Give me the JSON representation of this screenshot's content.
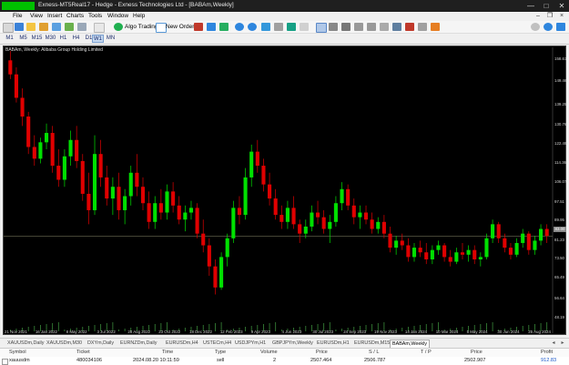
{
  "window": {
    "title": "Exness-MT5Real17 - Hedge - Exness Technologies Ltd - [BABAm,Weekly]",
    "controls": [
      "—",
      "□",
      "✕"
    ]
  },
  "menu": {
    "items": [
      "File",
      "View",
      "Insert",
      "Charts",
      "Tools",
      "Window",
      "Help"
    ]
  },
  "toolbar": {
    "algo_label": "Algo Trading",
    "new_order_label": "New Order"
  },
  "timeframes": [
    "M1",
    "M5",
    "M15",
    "M30",
    "H1",
    "H4",
    "D1",
    "W1",
    "MN"
  ],
  "active_timeframe": "W1",
  "chart": {
    "caption": "BABAm, Weekly:  Alibaba Group Holding Limited",
    "current_price_label": "83.00",
    "bull_color": "#00e000",
    "bear_color": "#e00000",
    "price_line_color": "#8a8a6a"
  },
  "chart_data": {
    "type": "candlestick",
    "y_ticks": [
      "158.61",
      "149.46",
      "139.25",
      "130.76",
      "122.49",
      "114.36",
      "106.07",
      "97.51",
      "89.95",
      "81.23",
      "73.50",
      "65.49",
      "56.64",
      "48.19"
    ],
    "x_ticks": [
      "21 Nov 2021",
      "16 Jan 2022",
      "8 May 2022",
      "3 Jul 2022",
      "28 Aug 2022",
      "23 Oct 2022",
      "18 Dec 2022",
      "12 Feb 2023",
      "9 Apr 2023",
      "4 Jun 2023",
      "30 Jul 2023",
      "24 Sep 2023",
      "19 Nov 2023",
      "14 Jan 2024",
      "10 Mar 2024",
      "5 May 2024",
      "30 Jun 2024",
      "25 Aug 2024"
    ],
    "ylim": [
      45,
      162
    ],
    "current_price": 83.0,
    "candles": [
      {
        "o": 158,
        "h": 162,
        "l": 150,
        "c": 152
      },
      {
        "o": 152,
        "h": 155,
        "l": 140,
        "c": 142
      },
      {
        "o": 142,
        "h": 146,
        "l": 130,
        "c": 134
      },
      {
        "o": 134,
        "h": 136,
        "l": 118,
        "c": 121
      },
      {
        "o": 121,
        "h": 126,
        "l": 113,
        "c": 116
      },
      {
        "o": 116,
        "h": 125,
        "l": 114,
        "c": 123
      },
      {
        "o": 123,
        "h": 131,
        "l": 120,
        "c": 127
      },
      {
        "o": 127,
        "h": 130,
        "l": 110,
        "c": 113
      },
      {
        "o": 113,
        "h": 120,
        "l": 104,
        "c": 107
      },
      {
        "o": 107,
        "h": 120,
        "l": 104,
        "c": 117
      },
      {
        "o": 117,
        "h": 128,
        "l": 113,
        "c": 124
      },
      {
        "o": 124,
        "h": 130,
        "l": 112,
        "c": 115
      },
      {
        "o": 115,
        "h": 118,
        "l": 98,
        "c": 101
      },
      {
        "o": 101,
        "h": 110,
        "l": 88,
        "c": 94
      },
      {
        "o": 94,
        "h": 126,
        "l": 92,
        "c": 118
      },
      {
        "o": 118,
        "h": 124,
        "l": 104,
        "c": 108
      },
      {
        "o": 108,
        "h": 113,
        "l": 96,
        "c": 99
      },
      {
        "o": 99,
        "h": 108,
        "l": 92,
        "c": 104
      },
      {
        "o": 104,
        "h": 110,
        "l": 90,
        "c": 94
      },
      {
        "o": 94,
        "h": 103,
        "l": 88,
        "c": 100
      },
      {
        "o": 100,
        "h": 113,
        "l": 96,
        "c": 110
      },
      {
        "o": 110,
        "h": 118,
        "l": 100,
        "c": 104
      },
      {
        "o": 104,
        "h": 108,
        "l": 94,
        "c": 97
      },
      {
        "o": 97,
        "h": 102,
        "l": 86,
        "c": 89
      },
      {
        "o": 89,
        "h": 100,
        "l": 86,
        "c": 97
      },
      {
        "o": 97,
        "h": 103,
        "l": 90,
        "c": 93
      },
      {
        "o": 93,
        "h": 105,
        "l": 90,
        "c": 102
      },
      {
        "o": 102,
        "h": 106,
        "l": 93,
        "c": 96
      },
      {
        "o": 96,
        "h": 100,
        "l": 88,
        "c": 90
      },
      {
        "o": 90,
        "h": 96,
        "l": 85,
        "c": 93
      },
      {
        "o": 93,
        "h": 98,
        "l": 90,
        "c": 95
      },
      {
        "o": 95,
        "h": 97,
        "l": 82,
        "c": 84
      },
      {
        "o": 84,
        "h": 90,
        "l": 76,
        "c": 79
      },
      {
        "o": 79,
        "h": 82,
        "l": 66,
        "c": 70
      },
      {
        "o": 70,
        "h": 73,
        "l": 58,
        "c": 61
      },
      {
        "o": 61,
        "h": 76,
        "l": 60,
        "c": 74
      },
      {
        "o": 74,
        "h": 84,
        "l": 70,
        "c": 82
      },
      {
        "o": 82,
        "h": 98,
        "l": 80,
        "c": 95
      },
      {
        "o": 95,
        "h": 100,
        "l": 88,
        "c": 92
      },
      {
        "o": 92,
        "h": 112,
        "l": 90,
        "c": 108
      },
      {
        "o": 108,
        "h": 122,
        "l": 104,
        "c": 119
      },
      {
        "o": 119,
        "h": 124,
        "l": 110,
        "c": 113
      },
      {
        "o": 113,
        "h": 116,
        "l": 102,
        "c": 105
      },
      {
        "o": 105,
        "h": 110,
        "l": 96,
        "c": 99
      },
      {
        "o": 99,
        "h": 103,
        "l": 90,
        "c": 92
      },
      {
        "o": 92,
        "h": 96,
        "l": 86,
        "c": 89
      },
      {
        "o": 89,
        "h": 98,
        "l": 86,
        "c": 95
      },
      {
        "o": 95,
        "h": 100,
        "l": 86,
        "c": 88
      },
      {
        "o": 88,
        "h": 90,
        "l": 80,
        "c": 84
      },
      {
        "o": 84,
        "h": 90,
        "l": 82,
        "c": 87
      },
      {
        "o": 87,
        "h": 96,
        "l": 85,
        "c": 93
      },
      {
        "o": 93,
        "h": 98,
        "l": 88,
        "c": 91
      },
      {
        "o": 91,
        "h": 94,
        "l": 84,
        "c": 86
      },
      {
        "o": 86,
        "h": 92,
        "l": 80,
        "c": 89
      },
      {
        "o": 89,
        "h": 100,
        "l": 87,
        "c": 97
      },
      {
        "o": 97,
        "h": 106,
        "l": 94,
        "c": 103
      },
      {
        "o": 103,
        "h": 105,
        "l": 94,
        "c": 96
      },
      {
        "o": 96,
        "h": 99,
        "l": 88,
        "c": 91
      },
      {
        "o": 91,
        "h": 96,
        "l": 86,
        "c": 93
      },
      {
        "o": 93,
        "h": 96,
        "l": 88,
        "c": 90
      },
      {
        "o": 90,
        "h": 93,
        "l": 84,
        "c": 86
      },
      {
        "o": 86,
        "h": 91,
        "l": 84,
        "c": 89
      },
      {
        "o": 89,
        "h": 92,
        "l": 82,
        "c": 84
      },
      {
        "o": 84,
        "h": 87,
        "l": 76,
        "c": 78
      },
      {
        "o": 78,
        "h": 83,
        "l": 75,
        "c": 81
      },
      {
        "o": 81,
        "h": 84,
        "l": 77,
        "c": 79
      },
      {
        "o": 79,
        "h": 82,
        "l": 72,
        "c": 74
      },
      {
        "o": 74,
        "h": 80,
        "l": 72,
        "c": 78
      },
      {
        "o": 78,
        "h": 81,
        "l": 74,
        "c": 76
      },
      {
        "o": 76,
        "h": 80,
        "l": 71,
        "c": 73
      },
      {
        "o": 73,
        "h": 79,
        "l": 71,
        "c": 77
      },
      {
        "o": 77,
        "h": 81,
        "l": 75,
        "c": 79
      },
      {
        "o": 79,
        "h": 80,
        "l": 72,
        "c": 74
      },
      {
        "o": 74,
        "h": 77,
        "l": 70,
        "c": 72
      },
      {
        "o": 72,
        "h": 78,
        "l": 71,
        "c": 76
      },
      {
        "o": 76,
        "h": 80,
        "l": 73,
        "c": 75
      },
      {
        "o": 75,
        "h": 79,
        "l": 72,
        "c": 77
      },
      {
        "o": 77,
        "h": 79,
        "l": 71,
        "c": 73
      },
      {
        "o": 73,
        "h": 76,
        "l": 70,
        "c": 74
      },
      {
        "o": 74,
        "h": 84,
        "l": 73,
        "c": 82
      },
      {
        "o": 82,
        "h": 90,
        "l": 80,
        "c": 88
      },
      {
        "o": 88,
        "h": 89,
        "l": 80,
        "c": 82
      },
      {
        "o": 82,
        "h": 84,
        "l": 76,
        "c": 78
      },
      {
        "o": 78,
        "h": 80,
        "l": 73,
        "c": 75
      },
      {
        "o": 75,
        "h": 82,
        "l": 74,
        "c": 80
      },
      {
        "o": 80,
        "h": 86,
        "l": 78,
        "c": 84
      },
      {
        "o": 84,
        "h": 85,
        "l": 75,
        "c": 77
      },
      {
        "o": 77,
        "h": 83,
        "l": 75,
        "c": 81
      },
      {
        "o": 81,
        "h": 88,
        "l": 79,
        "c": 86
      },
      {
        "o": 86,
        "h": 88,
        "l": 80,
        "c": 83
      }
    ]
  },
  "symbol_tabs": [
    "XAUUSDm,Daily",
    "XAUUSDm,M30",
    "DXYm,Daily",
    "EURNZDm,Daily",
    "EURUSDm,H4",
    "USTECm,H4",
    "USDJPYm,H1",
    "GBPJPYm,Weekly",
    "EURUSDm,H1",
    "EURUSDm,M15",
    "BABAm,Weekly"
  ],
  "active_tab": "BABAm,Weekly",
  "trade_table": {
    "headers": [
      "Symbol",
      "Ticket",
      "Time",
      "Type",
      "Volume",
      "Price",
      "S / L",
      "T / P",
      "Price",
      "Profit"
    ],
    "rows": [
      {
        "symbol": "xauusdm",
        "ticket": "480034106",
        "time": "2024.08.20 10:11:59",
        "type": "sell",
        "volume": "2",
        "price": "2507.464",
        "sl": "2506.787",
        "tp": "",
        "price2": "2502.907",
        "profit": "912.83"
      }
    ]
  }
}
